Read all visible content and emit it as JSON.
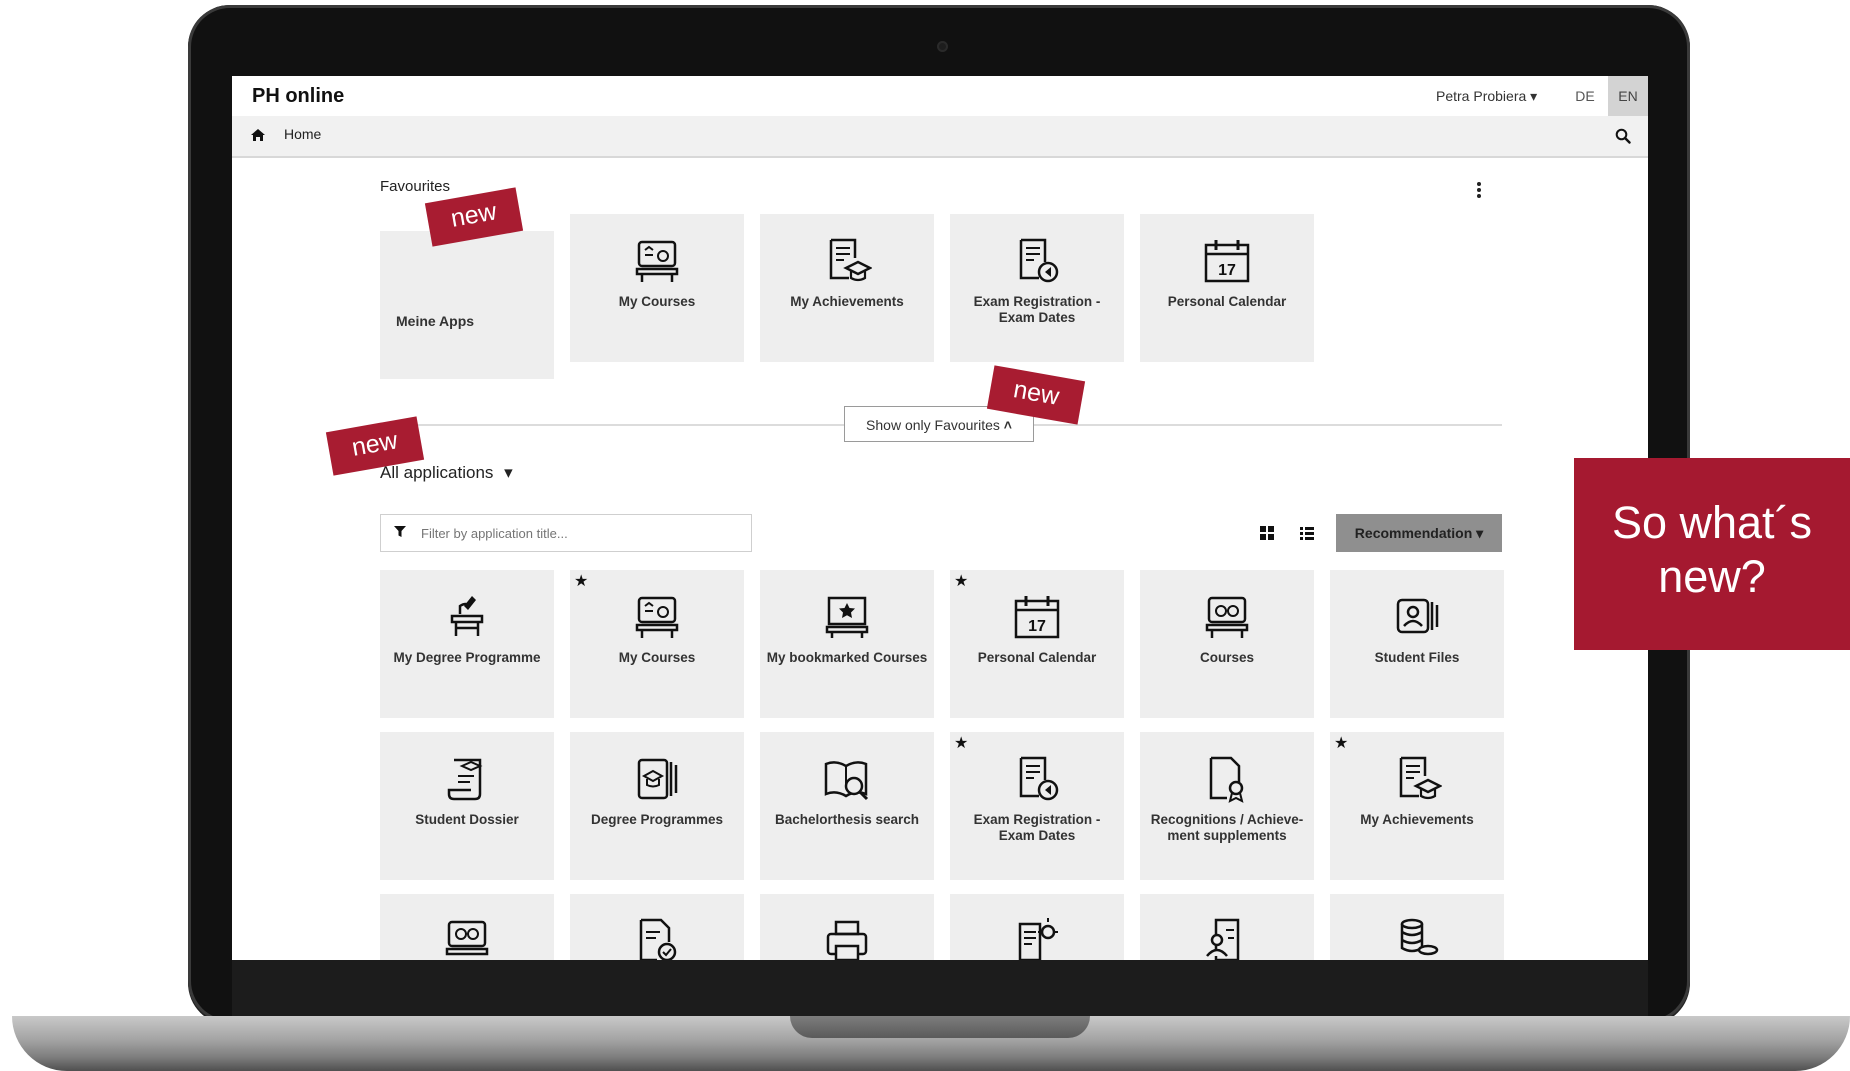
{
  "header": {
    "app_title": "PH online",
    "user_name": "Petra Probiera",
    "lang_de": "DE",
    "lang_en": "EN"
  },
  "nav": {
    "home_label": "Home"
  },
  "favourites": {
    "title": "Favourites",
    "tiles": [
      {
        "label": "Meine Apps"
      },
      {
        "label": "My Courses",
        "icon": "course-board-icon"
      },
      {
        "label": "My Achievements",
        "icon": "achievements-icon"
      },
      {
        "label": "Exam Registration - Exam Dates",
        "icon": "exam-registration-icon"
      },
      {
        "label": "Personal Calendar",
        "icon": "calendar-icon"
      }
    ]
  },
  "toggle": {
    "label": "Show only Favourites"
  },
  "all_apps": {
    "title": "All applications",
    "filter_placeholder": "Filter by application title...",
    "sort_label": "Recommendation",
    "tiles": [
      {
        "label": "My Degree Programme",
        "starred": false
      },
      {
        "label": "My Courses",
        "starred": true
      },
      {
        "label": "My bookmarked Courses",
        "starred": false
      },
      {
        "label": "Personal Calendar",
        "starred": true
      },
      {
        "label": "Courses",
        "starred": false
      },
      {
        "label": "Student Files",
        "starred": false
      },
      {
        "label": "Student Dossier",
        "starred": false
      },
      {
        "label": "Degree Programmes",
        "starred": false
      },
      {
        "label": "Bachelorthesis search",
        "starred": false
      },
      {
        "label": "Exam Registration - Exam Dates",
        "starred": true
      },
      {
        "label": "Recognitions / Achieve-ment supplements",
        "starred": false
      },
      {
        "label": "My Achievements",
        "starred": true
      }
    ]
  },
  "badges": {
    "new_1": "new",
    "new_2": "new",
    "new_3": "new"
  },
  "callout": {
    "line1": "So what´s",
    "line2": "new?"
  },
  "colors": {
    "accent": "#a81c31",
    "tile_bg": "#eeeeee",
    "nav_bg": "#f1f1f1"
  }
}
